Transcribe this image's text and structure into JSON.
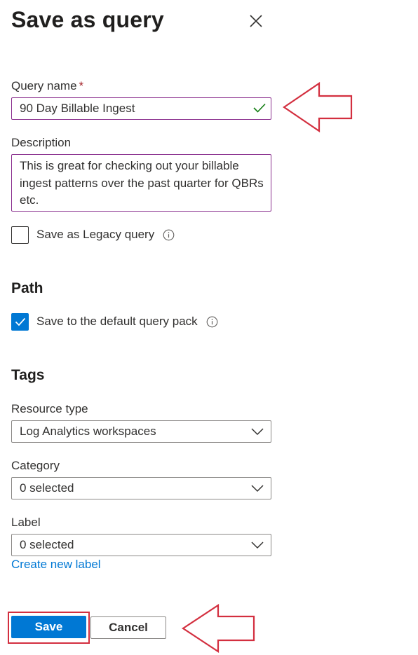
{
  "panel": {
    "title": "Save as query"
  },
  "query_name": {
    "label": "Query name",
    "required_mark": "*",
    "value": "90 Day Billable Ingest"
  },
  "description": {
    "label": "Description",
    "value": "This is great for checking out your billable ingest patterns over the past quarter for QBRs etc."
  },
  "legacy": {
    "label": "Save as Legacy query",
    "checked": false
  },
  "path": {
    "heading": "Path",
    "default_pack_label": "Save to the default query pack",
    "checked": true
  },
  "tags": {
    "heading": "Tags",
    "resource_type": {
      "label": "Resource type",
      "value": "Log Analytics workspaces"
    },
    "category": {
      "label": "Category",
      "value": "0 selected"
    },
    "label_field": {
      "label": "Label",
      "value": "0 selected"
    },
    "create_label_link": "Create new label"
  },
  "actions": {
    "save": "Save",
    "cancel": "Cancel"
  },
  "colors": {
    "primary": "#0078d4",
    "focus_border": "#8a2f8e",
    "success_check": "#107c10",
    "annotation": "#d32f3f"
  }
}
